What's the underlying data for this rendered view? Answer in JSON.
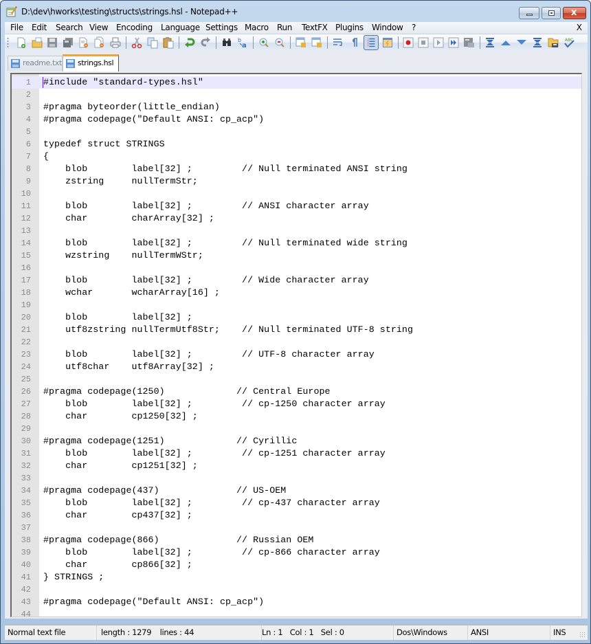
{
  "window": {
    "title": "D:\\dev\\hworks\\testing\\structs\\strings.hsl - Notepad++",
    "close_glyph": "x"
  },
  "menubar": {
    "items": [
      "File",
      "Edit",
      "Search",
      "View",
      "Encoding",
      "Language",
      "Settings",
      "Macro",
      "Run",
      "TextFX",
      "Plugins",
      "Window",
      "?"
    ],
    "close_doc": "X"
  },
  "toolbar": {
    "buttons": [
      "new-file",
      "open-file",
      "save",
      "save-all",
      "close",
      "close-all",
      "print",
      "cut",
      "copy",
      "paste",
      "undo",
      "redo",
      "find",
      "replace",
      "zoom-in",
      "zoom-out",
      "sync-vertical",
      "sync-horizontal",
      "word-wrap",
      "show-all-characters",
      "indent-guide",
      "user-defined-language",
      "macro-record",
      "macro-stop",
      "macro-play",
      "macro-run-multiple",
      "macro-save",
      "fold-first",
      "fold-up",
      "fold-down",
      "fold-last",
      "document-map",
      "spell-check"
    ],
    "pressed": "indent-guide"
  },
  "tabs": [
    {
      "label": "readme.txt",
      "active": false
    },
    {
      "label": "strings.hsl",
      "active": true
    }
  ],
  "editor": {
    "current_line": 1,
    "lines": [
      "#include \"standard-types.hsl\"",
      "",
      "#pragma byteorder(little_endian)",
      "#pragma codepage(\"Default ANSI: cp_acp\")",
      "",
      "typedef struct STRINGS",
      "{",
      "    blob        label[32] ;         // Null terminated ANSI string",
      "    zstring     nullTermStr;",
      "",
      "    blob        label[32] ;         // ANSI character array",
      "    char        charArray[32] ;",
      "",
      "    blob        label[32] ;         // Null terminated wide string",
      "    wzstring    nullTermWStr;",
      "",
      "    blob        label[32] ;         // Wide character array",
      "    wchar       wcharArray[16] ;",
      "",
      "    blob        label[32] ;",
      "    utf8zstring nullTermUtf8Str;    // Null terminated UTF-8 string",
      "",
      "    blob        label[32] ;         // UTF-8 character array",
      "    utf8char    utf8Array[32] ;",
      "",
      "#pragma codepage(1250)             // Central Europe",
      "    blob        label[32] ;         // cp-1250 character array",
      "    char        cp1250[32] ;",
      "",
      "#pragma codepage(1251)             // Cyrillic",
      "    blob        label[32] ;         // cp-1251 character array",
      "    char        cp1251[32] ;",
      "",
      "#pragma codepage(437)              // US-OEM",
      "    blob        label[32] ;         // cp-437 character array",
      "    char        cp437[32] ;",
      "",
      "#pragma codepage(866)              // Russian OEM",
      "    blob        label[32] ;         // cp-866 character array",
      "    char        cp866[32] ;",
      "} STRINGS ;",
      "",
      "#pragma codepage(\"Default ANSI: cp_acp\")",
      ""
    ]
  },
  "statusbar": {
    "file_type": "Normal text file",
    "length": "length : 1279",
    "lines": "lines : 44",
    "ln": "Ln : 1",
    "col": "Col : 1",
    "sel": "Sel : 0",
    "eol": "Dos\\Windows",
    "encoding": "ANSI",
    "mode": "INS"
  }
}
